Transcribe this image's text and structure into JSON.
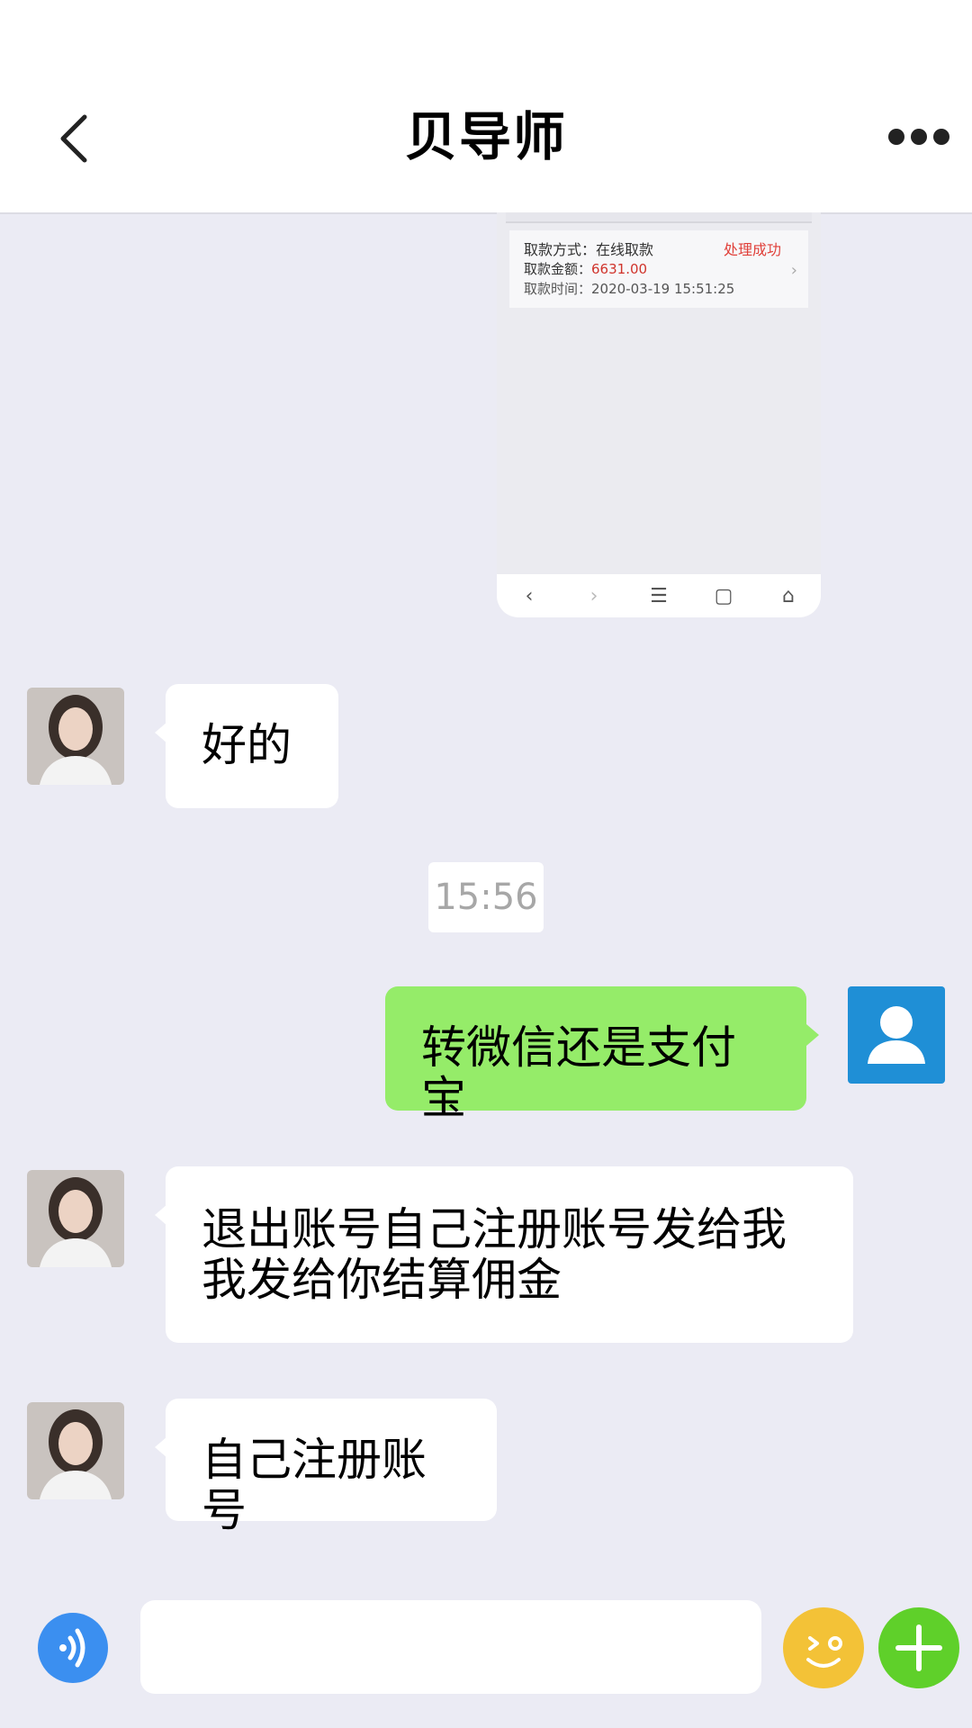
{
  "header": {
    "title": "贝导师",
    "back_icon": "chevron-left-icon",
    "more_icon": "more-dots-icon"
  },
  "image_message": {
    "method_label": "取款方式：",
    "method_value": "在线取款",
    "status": "处理成功",
    "amount_label": "取款金额：",
    "amount_value": "6631.00",
    "time_label": "取款时间：",
    "time_value": "2020-03-19 15:51:25"
  },
  "messages": [
    {
      "from": "other",
      "text": "好的"
    },
    {
      "from": "self",
      "text": "转微信还是支付宝"
    },
    {
      "from": "other",
      "line1": "退出账号自己注册账号发给我",
      "line2": "我发给你结算佣金"
    },
    {
      "from": "other",
      "text": "自己注册账号"
    }
  ],
  "time_divider": "15:56",
  "input": {
    "placeholder": ""
  },
  "colors": {
    "self_bubble": "#95ec69",
    "other_bubble": "#ffffff",
    "background": "#ebebf4",
    "status_red": "#e0403a"
  }
}
